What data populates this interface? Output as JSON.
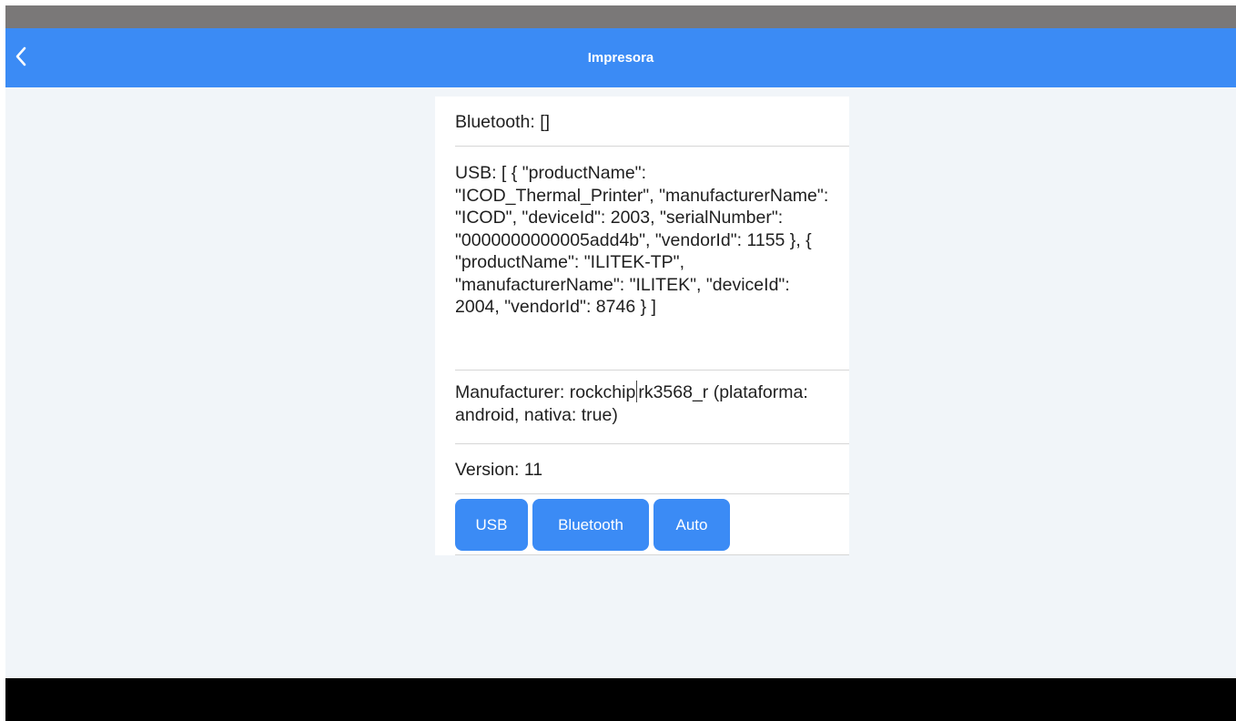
{
  "header": {
    "title": "Impresora",
    "back_icon": "chevron-left-icon"
  },
  "info": {
    "bluetooth": "Bluetooth: []",
    "usb": "USB: [ { \"productName\": \"ICOD_Thermal_Printer\", \"manufacturerName\": \"ICOD\", \"deviceId\": 2003, \"serialNumber\": \"0000000000005add4b\", \"vendorId\": 1155 }, { \"productName\": \"ILITEK-TP\", \"manufacturerName\": \"ILITEK\", \"deviceId\": 2004, \"vendorId\": 8746 } ]",
    "manufacturer_before_caret": "Manufacturer: rockchip",
    "manufacturer_after_caret": "rk3568_r (plataforma: android, nativa: true)",
    "version": "Version: 11"
  },
  "buttons": {
    "usb": "USB",
    "bluetooth": "Bluetooth",
    "auto": "Auto"
  },
  "colors": {
    "accent": "#3b8bf5",
    "background": "#f1f5f9",
    "status_bar": "#7a7878",
    "nav_bar": "#000000"
  }
}
